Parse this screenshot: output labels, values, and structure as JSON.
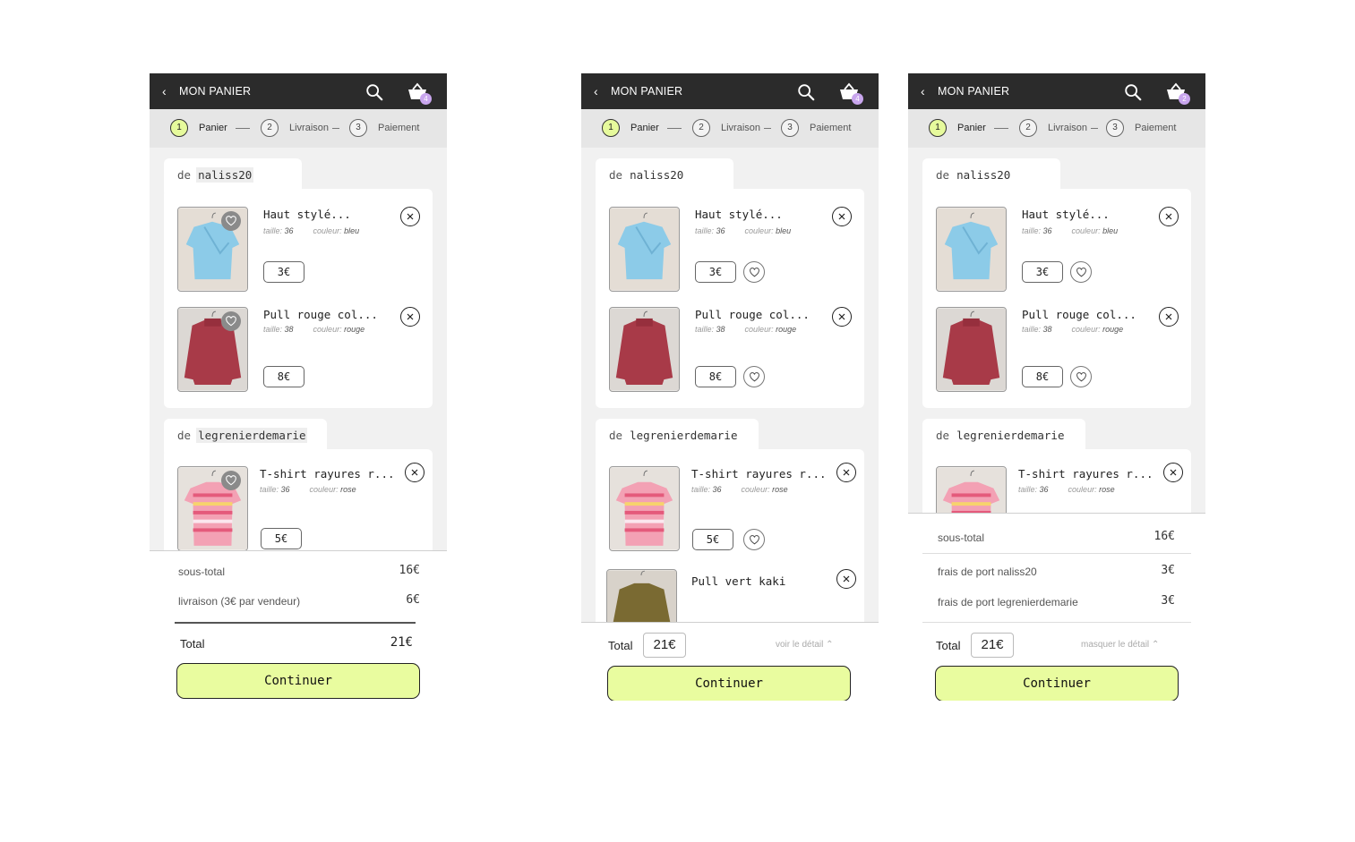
{
  "header": {
    "back_icon": "chevron-left-icon",
    "title": "MON PANIER",
    "search_icon": "search-icon",
    "cart_icon": "basket-icon"
  },
  "steps": [
    {
      "num": "1",
      "label": "Panier"
    },
    {
      "num": "2",
      "label": "Livraison"
    },
    {
      "num": "3",
      "label": "Paiement"
    }
  ],
  "colors": {
    "topbar": "#2b2b2b",
    "accent_lime": "#e9fc9f",
    "badge_purple": "#c9a6ee"
  },
  "vendors": [
    {
      "prefix": "de",
      "name": "naliss20"
    },
    {
      "prefix": "de",
      "name": "legrenierdemarie"
    }
  ],
  "items": [
    {
      "name": "Haut stylé...",
      "size_label": "taille:",
      "size": "36",
      "color_label": "couleur:",
      "color": "bleu",
      "price": "3€",
      "image": "blue-wrap-top-on-hanger"
    },
    {
      "name": "Pull rouge col...",
      "size_label": "taille:",
      "size": "38",
      "color_label": "couleur:",
      "color": "rouge",
      "price": "8€",
      "image": "red-turtleneck-sweater-on-hanger"
    },
    {
      "name": "T-shirt rayures r...",
      "size_label": "taille:",
      "size": "36",
      "color_label": "couleur:",
      "color": "rose",
      "price": "5€",
      "image": "pink-striped-tshirt-on-hanger"
    },
    {
      "name": "Pull vert kaki",
      "image": "khaki-green-sweater"
    }
  ],
  "screens": [
    {
      "cart_count": "4",
      "subtotal_label": "sous-total",
      "subtotal_value": "16€",
      "delivery_label": "livraison (3€ par vendeur)",
      "delivery_value": "6€",
      "total_label": "Total",
      "total_value": "21€",
      "continue_label": "Continuer"
    },
    {
      "cart_count": "4",
      "total_label": "Total",
      "total_value": "21€",
      "detail_link": "voir le détail",
      "continue_label": "Continuer"
    },
    {
      "cart_count": "2",
      "subtotal_label": "sous-total",
      "subtotal_value": "16€",
      "shipping1_label": "frais de port naliss20",
      "shipping1_value": "3€",
      "shipping2_label": "frais de port legrenierdemarie",
      "shipping2_value": "3€",
      "total_label": "Total",
      "total_value": "21€",
      "detail_link": "masquer le détail",
      "continue_label": "Continuer"
    }
  ]
}
